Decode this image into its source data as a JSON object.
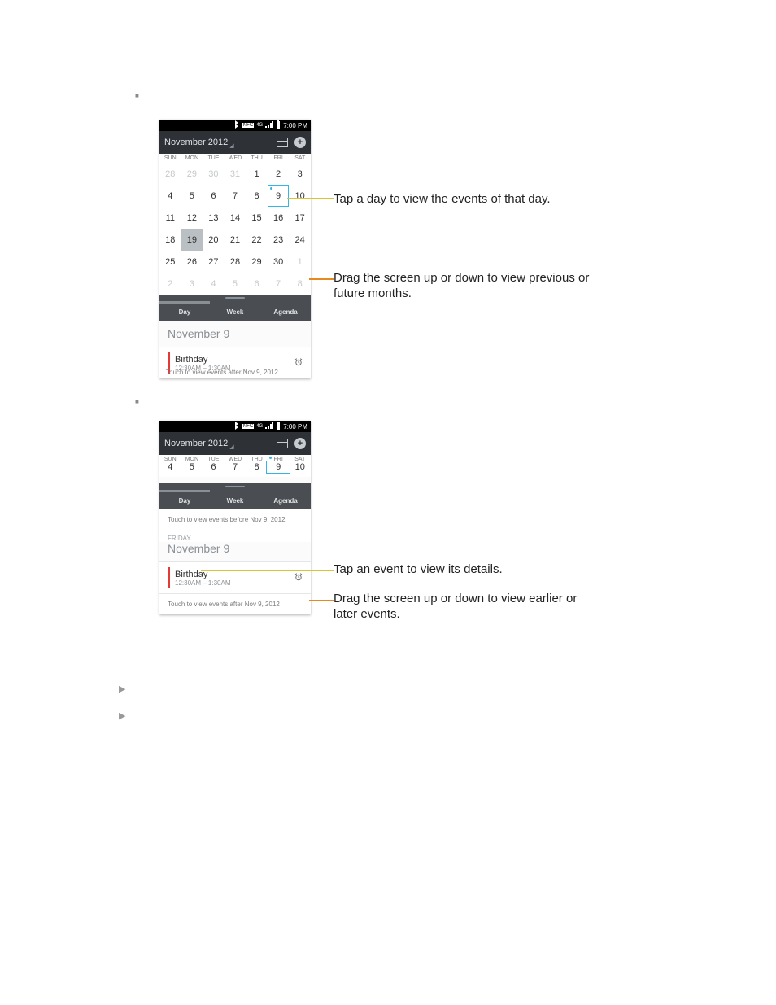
{
  "status": {
    "time": "7:00 PM",
    "nfc": "NFC",
    "net": "4G"
  },
  "header": {
    "title": "November 2012"
  },
  "dow": [
    "SUN",
    "MON",
    "TUE",
    "WED",
    "THU",
    "FRI",
    "SAT"
  ],
  "month": {
    "rows": [
      [
        {
          "n": "28",
          "f": 1
        },
        {
          "n": "29",
          "f": 1
        },
        {
          "n": "30",
          "f": 1
        },
        {
          "n": "31",
          "f": 1
        },
        {
          "n": "1"
        },
        {
          "n": "2"
        },
        {
          "n": "3"
        }
      ],
      [
        {
          "n": "4"
        },
        {
          "n": "5"
        },
        {
          "n": "6"
        },
        {
          "n": "7"
        },
        {
          "n": "8"
        },
        {
          "n": "9",
          "t": 1,
          "d": 1
        },
        {
          "n": "10"
        }
      ],
      [
        {
          "n": "11"
        },
        {
          "n": "12"
        },
        {
          "n": "13"
        },
        {
          "n": "14"
        },
        {
          "n": "15"
        },
        {
          "n": "16"
        },
        {
          "n": "17"
        }
      ],
      [
        {
          "n": "18"
        },
        {
          "n": "19",
          "s": 1
        },
        {
          "n": "20"
        },
        {
          "n": "21"
        },
        {
          "n": "22"
        },
        {
          "n": "23"
        },
        {
          "n": "24"
        }
      ],
      [
        {
          "n": "25"
        },
        {
          "n": "26"
        },
        {
          "n": "27"
        },
        {
          "n": "28"
        },
        {
          "n": "29"
        },
        {
          "n": "30"
        },
        {
          "n": "1",
          "f": 1
        }
      ],
      [
        {
          "n": "2",
          "f": 1
        },
        {
          "n": "3",
          "f": 1
        },
        {
          "n": "4",
          "f": 1
        },
        {
          "n": "5",
          "f": 1
        },
        {
          "n": "6",
          "f": 1
        },
        {
          "n": "7",
          "f": 1
        },
        {
          "n": "8",
          "f": 1
        }
      ]
    ]
  },
  "tabs": {
    "day": "Day",
    "week": "Week",
    "agenda": "Agenda"
  },
  "date_heading": "November 9",
  "weekday_label": "FRIDAY",
  "event": {
    "title": "Birthday",
    "sub": "12:30AM – 1:30AM"
  },
  "touch_after": "Touch to view events after Nov 9, 2012",
  "touch_before": "Touch to view events before Nov 9, 2012",
  "week": {
    "days": [
      {
        "d": "SUN",
        "n": "4"
      },
      {
        "d": "MON",
        "n": "5"
      },
      {
        "d": "TUE",
        "n": "6"
      },
      {
        "d": "WED",
        "n": "7"
      },
      {
        "d": "THU",
        "n": "8"
      },
      {
        "d": "FRI",
        "n": "9",
        "sel": 1
      },
      {
        "d": "SAT",
        "n": "10"
      }
    ]
  },
  "ann": {
    "a": "Tap a day to view the events of that day.",
    "b": "Drag the screen up or down to view previous or future months.",
    "c": "Tap an event to view its details.",
    "d": "Drag the screen up or down to view earlier or later events."
  }
}
